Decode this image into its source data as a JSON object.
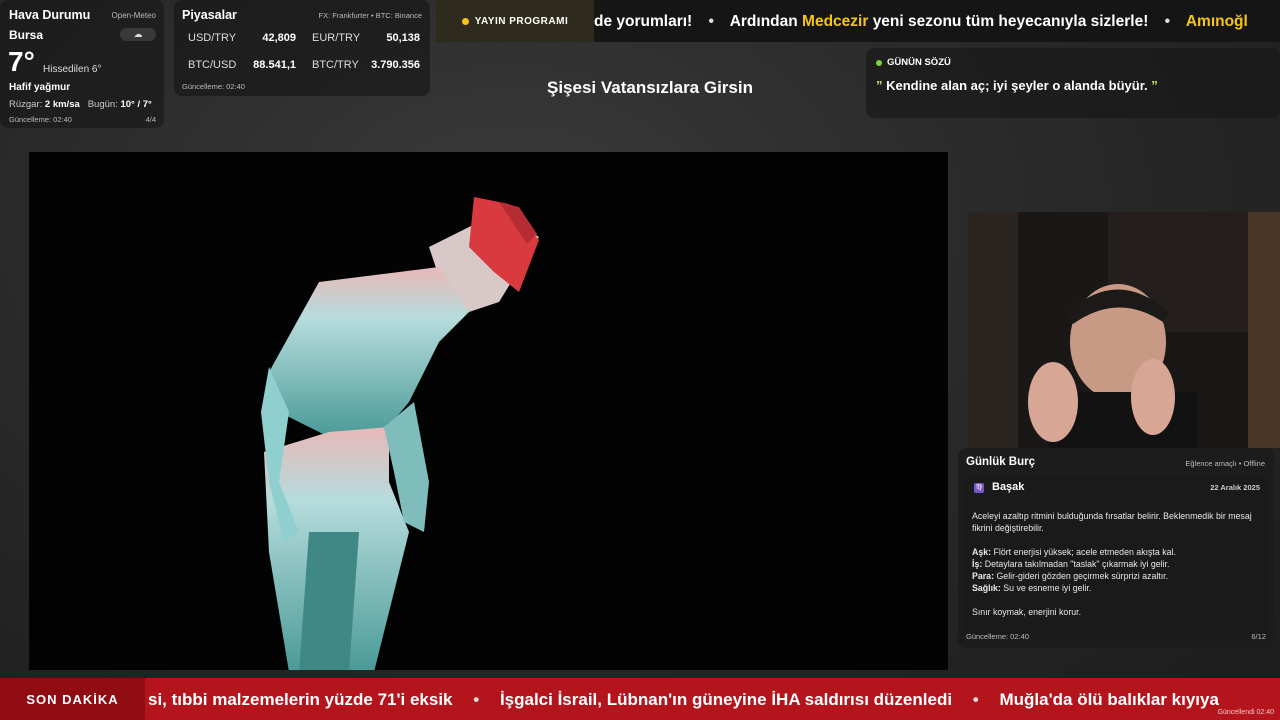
{
  "weather": {
    "title": "Hava Durumu",
    "source": "Open-Meteo",
    "city": "Bursa",
    "temp": "7°",
    "feels": "Hissedilen 6°",
    "desc": "Hafif yağmur",
    "wind_label": "Rüzgar:",
    "wind_value": "2 km/sa",
    "today_label": "Bugün:",
    "today_value": "10° / 7°",
    "updated": "Güncelleme: 02:40",
    "page": "4/4",
    "icon": "cloud-rain-icon"
  },
  "markets": {
    "title": "Piyasalar",
    "source": "FX: Frankfurter • BTC: Binance",
    "items": [
      {
        "label": "USD/TRY",
        "value": "42,809"
      },
      {
        "label": "EUR/TRY",
        "value": "50,138"
      },
      {
        "label": "BTC/USD",
        "value": "88.541,1"
      },
      {
        "label": "BTC/TRY",
        "value": "3.790.356"
      }
    ],
    "updated": "Güncelleme: 02:40"
  },
  "ticker_top": {
    "badge": "YAYIN PROGRAMI",
    "seg1": "de yorumları!",
    "seg2_pre": "Ardından",
    "seg2_hl": "Medcezir",
    "seg2_post": "yeni sezonu tüm heyecanıyla sizlerle!",
    "seg3": "Amınoğl",
    "separator": "•"
  },
  "stream_title": "Şişesi Vatansızlara Girsin",
  "quote": {
    "label": "GÜNÜN SÖZÜ",
    "open_mark": "”",
    "text": "Kendine alan aç; iyi şeyler o alanda büyür.",
    "close_mark": "”"
  },
  "horoscope": {
    "title": "Günlük Burç",
    "tag": "Eğlence amaçlı • Offline",
    "sign": "Başak",
    "sign_symbol": "♍",
    "date": "22 Aralık 2025",
    "intro": "Aceleyi azaltıp ritmini bulduğunda fırsatlar belirir. Beklenmedik bir mesaj fikrini değiştirebilir.",
    "love_label": "Aşk:",
    "love": "Flört enerjisi yüksek; acele etmeden akışta kal.",
    "work_label": "İş:",
    "work": "Detaylara takılmadan \"taslak\" çıkarmak iyi gelir.",
    "money_label": "Para:",
    "money": "Gelir-gideri gözden geçirmek sürprizi azaltır.",
    "health_label": "Sağlık:",
    "health": "Su ve esneme iyi gelir.",
    "outro": "Sınır koymak, enerjini korur.",
    "updated": "Güncelleme: 02:40",
    "page": "6/12"
  },
  "breaking": {
    "badge": "SON DAKİKA",
    "items": [
      "si, tıbbi malzemelerin yüzde 71'i eksik",
      "İşgalci İsrail, Lübnan'ın güneyine İHA saldırısı düzenledi",
      "Muğla'da ölü balıklar kıyıya"
    ],
    "separator": "•",
    "updated": "Güncellendi 02:40"
  },
  "colors": {
    "accent_yellow": "#f5c518",
    "breaking_red": "#b4141c",
    "live_green": "#7bd63a"
  }
}
